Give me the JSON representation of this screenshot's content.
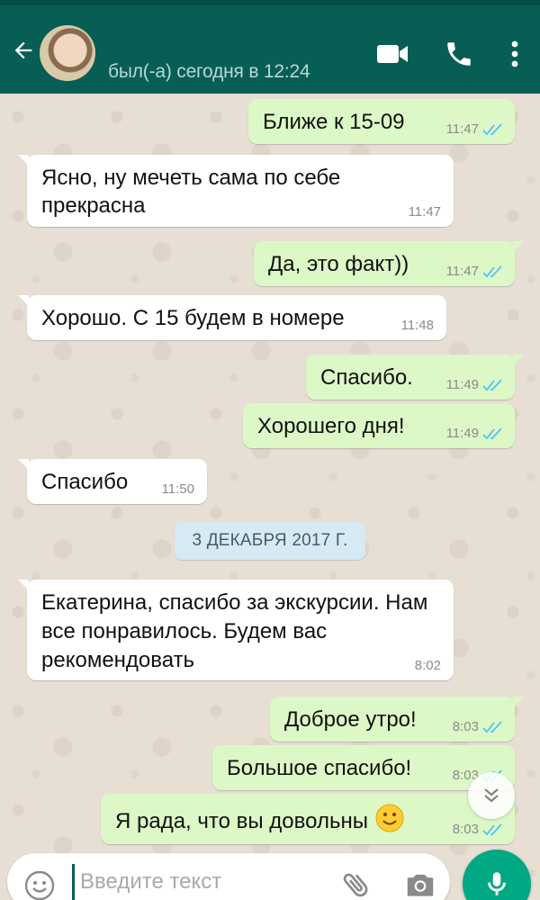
{
  "header": {
    "status": "был(-а) сегодня в 12:24"
  },
  "messages": [
    {
      "dir": "out",
      "text": "Ближе к 15-09",
      "time": "11:47"
    },
    {
      "dir": "in",
      "text": "Ясно, ну мечеть сама по себе прекрасна",
      "time": "11:47"
    },
    {
      "dir": "out",
      "text": "Да, это факт))",
      "time": "11:47"
    },
    {
      "dir": "in",
      "text": "Хорошо. С 15 будем в номере",
      "time": "11:48"
    },
    {
      "dir": "out",
      "text": "Спасибо.",
      "time": "11:49"
    },
    {
      "dir": "out",
      "text": "Хорошего дня!",
      "time": "11:49"
    },
    {
      "dir": "in",
      "text": "Спасибо",
      "time": "11:50"
    },
    {
      "dir": "in",
      "text": "Екатерина, спасибо за экскурсии. Нам все понравилось. Будем вас рекомендовать",
      "time": "8:02"
    },
    {
      "dir": "out",
      "text": "Доброе утро!",
      "time": "8:03"
    },
    {
      "dir": "out",
      "text": "Большое спасибо!",
      "time": "8:03"
    },
    {
      "dir": "out",
      "text": "Я рада, что вы довольны",
      "time": "8:03"
    }
  ],
  "date_divider": "3 ДЕКАБРЯ 2017 Г.",
  "composer": {
    "placeholder": "Введите текст"
  },
  "colors": {
    "header": "#075e54",
    "outgoing_bubble": "#dcf8c6",
    "incoming_bubble": "#ffffff",
    "read_ticks": "#4fc3f7",
    "mic_button": "#00a884"
  }
}
